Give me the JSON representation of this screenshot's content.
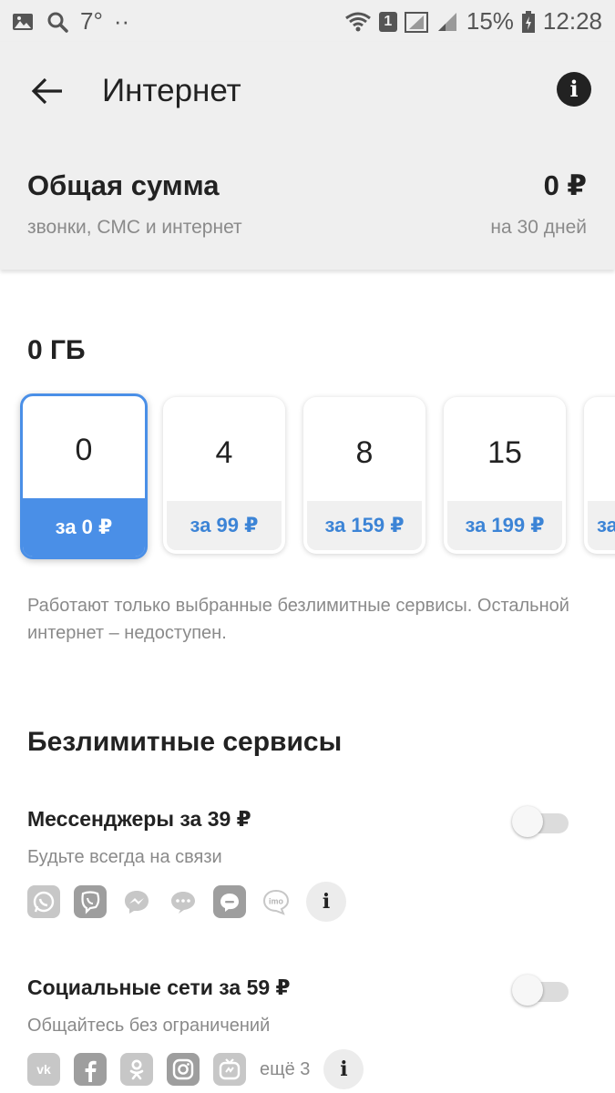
{
  "status_bar": {
    "temperature": "7°",
    "dots": "··",
    "sim_slot": "1",
    "battery": "15%",
    "time": "12:28",
    "icons": [
      "gallery-icon",
      "search-icon",
      "wifi-icon",
      "signal-icon",
      "battery-icon"
    ]
  },
  "header": {
    "title": "Интернет",
    "total_label": "Общая сумма",
    "total_sub": "звонки, СМС и интернет",
    "total_amount": "0 ₽",
    "total_period": "на 30 дней"
  },
  "volume": {
    "selected_label": "0 ГБ",
    "options": [
      {
        "gb": "0",
        "price": "за 0 ₽",
        "selected": true
      },
      {
        "gb": "4",
        "price": "за 99 ₽",
        "selected": false
      },
      {
        "gb": "8",
        "price": "за 159 ₽",
        "selected": false
      },
      {
        "gb": "15",
        "price": "за 199 ₽",
        "selected": false
      },
      {
        "gb": "",
        "price": "за",
        "selected": false
      }
    ],
    "note": "Работают только выбранные безлимитные сервисы. Остальной интернет – недоступен."
  },
  "unlimited": {
    "title": "Безлимитные сервисы",
    "services": [
      {
        "title": "Мессенджеры за 39 ₽",
        "subtitle": "Будьте всегда на связи",
        "enabled": false,
        "apps": [
          "whatsapp-icon",
          "viber-icon",
          "messenger-icon",
          "hangouts-chat-icon",
          "chat-bubble-icon",
          "imo-icon"
        ],
        "more": ""
      },
      {
        "title": "Социальные сети за 59 ₽",
        "subtitle": "Общайтесь без ограничений",
        "enabled": false,
        "apps": [
          "vk-icon",
          "facebook-icon",
          "odnoklassniki-icon",
          "instagram-icon",
          "igtv-icon"
        ],
        "more": "ещё 3"
      }
    ]
  },
  "colors": {
    "accent": "#4a8fe7",
    "price_text": "#3c84d6",
    "header_bg": "#efefef",
    "muted_text": "#8a8a8a"
  }
}
